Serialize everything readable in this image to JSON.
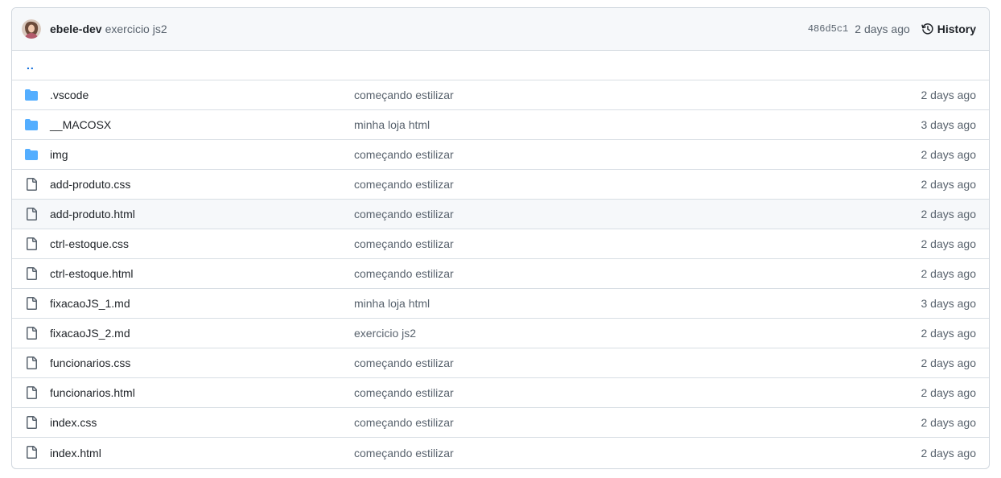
{
  "header": {
    "author": "ebele-dev",
    "message": "exercicio js2",
    "sha": "486d5c1",
    "age": "2 days ago",
    "history_label": "History"
  },
  "colors": {
    "folder": "#54aeff",
    "file_icon": "#59636e",
    "link": "#0969da"
  },
  "parent_dir": "..",
  "files": [
    {
      "type": "folder",
      "icon": "folder-icon",
      "name": ".vscode",
      "commit": "começando estilizar",
      "date": "2 days ago"
    },
    {
      "type": "folder",
      "icon": "folder-icon",
      "name": "__MACOSX",
      "commit": "minha loja html",
      "date": "3 days ago"
    },
    {
      "type": "folder",
      "icon": "folder-icon",
      "name": "img",
      "commit": "começando estilizar",
      "date": "2 days ago"
    },
    {
      "type": "file",
      "icon": "file-icon",
      "name": "add-produto.css",
      "commit": "começando estilizar",
      "date": "2 days ago"
    },
    {
      "type": "file",
      "icon": "file-icon",
      "name": "add-produto.html",
      "commit": "começando estilizar",
      "date": "2 days ago"
    },
    {
      "type": "file",
      "icon": "file-icon",
      "name": "ctrl-estoque.css",
      "commit": "começando estilizar",
      "date": "2 days ago"
    },
    {
      "type": "file",
      "icon": "file-icon",
      "name": "ctrl-estoque.html",
      "commit": "começando estilizar",
      "date": "2 days ago"
    },
    {
      "type": "file",
      "icon": "file-icon",
      "name": "fixacaoJS_1.md",
      "commit": "minha loja html",
      "date": "3 days ago"
    },
    {
      "type": "file",
      "icon": "file-icon",
      "name": "fixacaoJS_2.md",
      "commit": "exercicio js2",
      "date": "2 days ago"
    },
    {
      "type": "file",
      "icon": "file-icon",
      "name": "funcionarios.css",
      "commit": "começando estilizar",
      "date": "2 days ago"
    },
    {
      "type": "file",
      "icon": "file-icon",
      "name": "funcionarios.html",
      "commit": "começando estilizar",
      "date": "2 days ago"
    },
    {
      "type": "file",
      "icon": "file-icon",
      "name": "index.css",
      "commit": "começando estilizar",
      "date": "2 days ago"
    },
    {
      "type": "file",
      "icon": "file-icon",
      "name": "index.html",
      "commit": "começando estilizar",
      "date": "2 days ago"
    }
  ]
}
